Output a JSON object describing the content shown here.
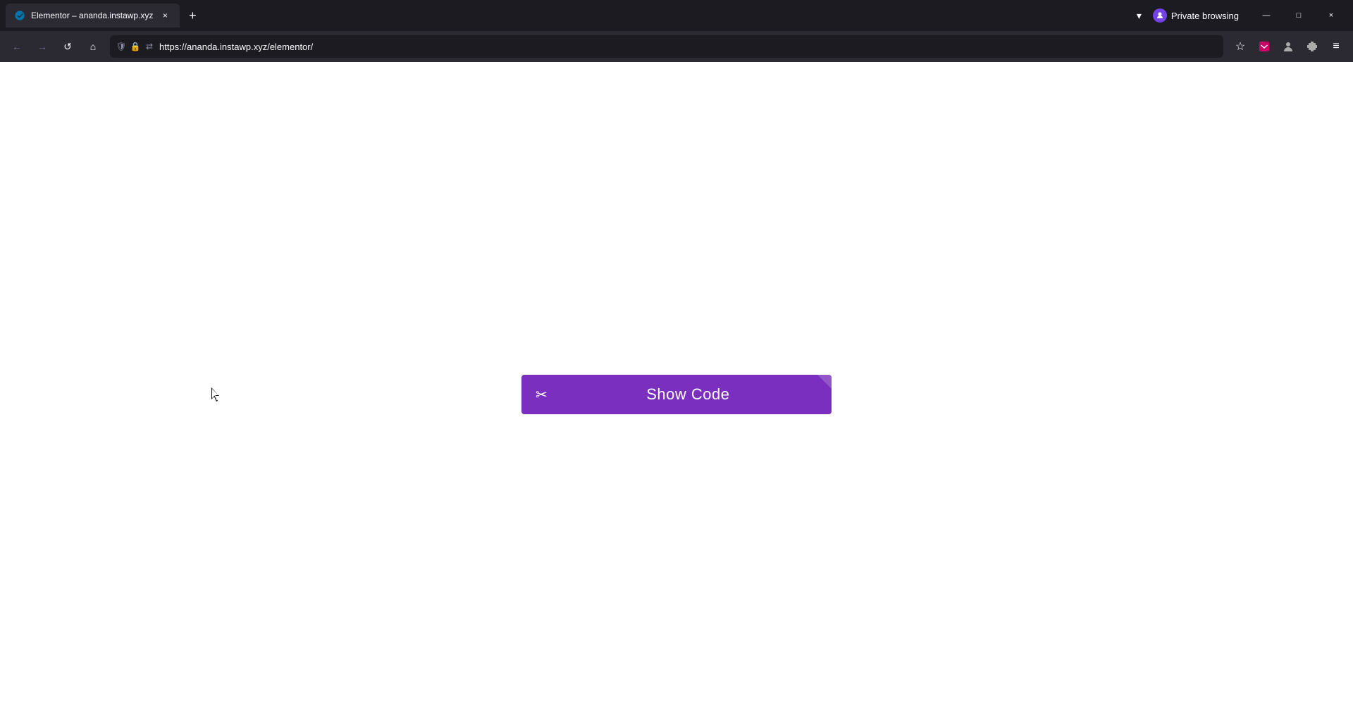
{
  "browser": {
    "tab": {
      "title": "Elementor – ananda.instawp.xyz",
      "url": "https://ananda.instawp.xyz/elementor/"
    },
    "new_tab_label": "+",
    "tab_dropdown_label": "▾",
    "private_browsing_label": "Private browsing",
    "nav": {
      "back_label": "←",
      "forward_label": "→",
      "refresh_label": "↺",
      "home_label": "⌂",
      "url": "https://ananda.instawp.xyz/elementor/"
    },
    "window_controls": {
      "minimize": "—",
      "maximize": "□",
      "close": "×"
    }
  },
  "page": {
    "show_code_button_label": "Show Code",
    "scissors_icon": "✂"
  }
}
